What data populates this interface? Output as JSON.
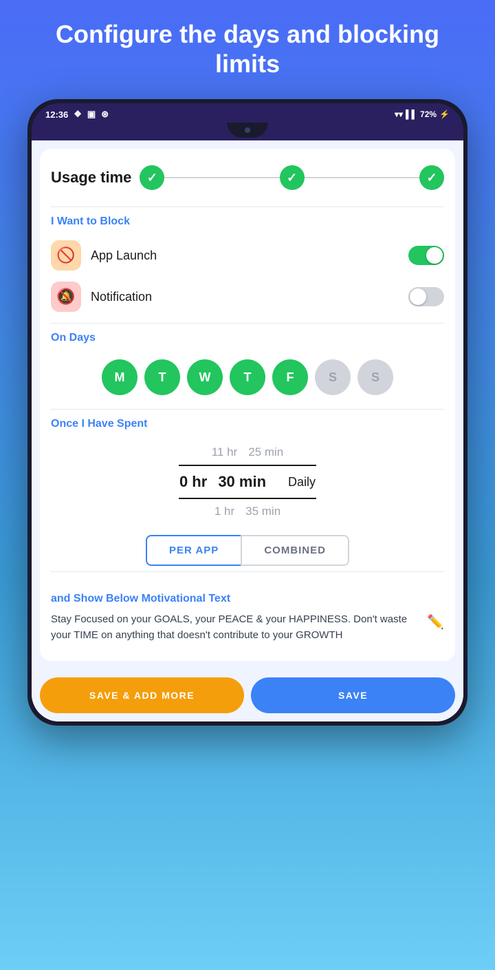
{
  "header": {
    "title": "Configure the days and blocking limits"
  },
  "statusBar": {
    "time": "12:36",
    "battery": "72%"
  },
  "stepper": {
    "title": "Usage time",
    "steps": [
      {
        "status": "done"
      },
      {
        "status": "done"
      },
      {
        "status": "done"
      }
    ]
  },
  "blockSection": {
    "label": "I Want to Block",
    "items": [
      {
        "name": "App Launch",
        "icon": "🚫",
        "iconBg": "orange",
        "toggleOn": true
      },
      {
        "name": "Notification",
        "icon": "🔕",
        "iconBg": "red",
        "toggleOn": false
      }
    ]
  },
  "daysSection": {
    "label": "On Days",
    "days": [
      {
        "letter": "M",
        "active": true
      },
      {
        "letter": "T",
        "active": true
      },
      {
        "letter": "W",
        "active": true
      },
      {
        "letter": "T",
        "active": true
      },
      {
        "letter": "F",
        "active": true
      },
      {
        "letter": "S",
        "active": false
      },
      {
        "letter": "S",
        "active": false
      }
    ]
  },
  "spentSection": {
    "label": "Once I Have Spent",
    "above": {
      "hr": "11 hr",
      "min": "25 min"
    },
    "selected": {
      "hr": "0 hr",
      "min": "30 min",
      "period": "Daily"
    },
    "below": {
      "hr": "1 hr",
      "min": "35 min"
    }
  },
  "tabs": {
    "perApp": "PER APP",
    "combined": "COMBINED"
  },
  "motivSection": {
    "label": "and Show Below Motivational Text",
    "text": "Stay Focused on your GOALS, your PEACE & your HAPPINESS. Don't waste your TIME on anything that doesn't contribute to your GROWTH"
  },
  "buttons": {
    "saveAdd": "SAVE & ADD MORE",
    "save": "SAVE"
  }
}
